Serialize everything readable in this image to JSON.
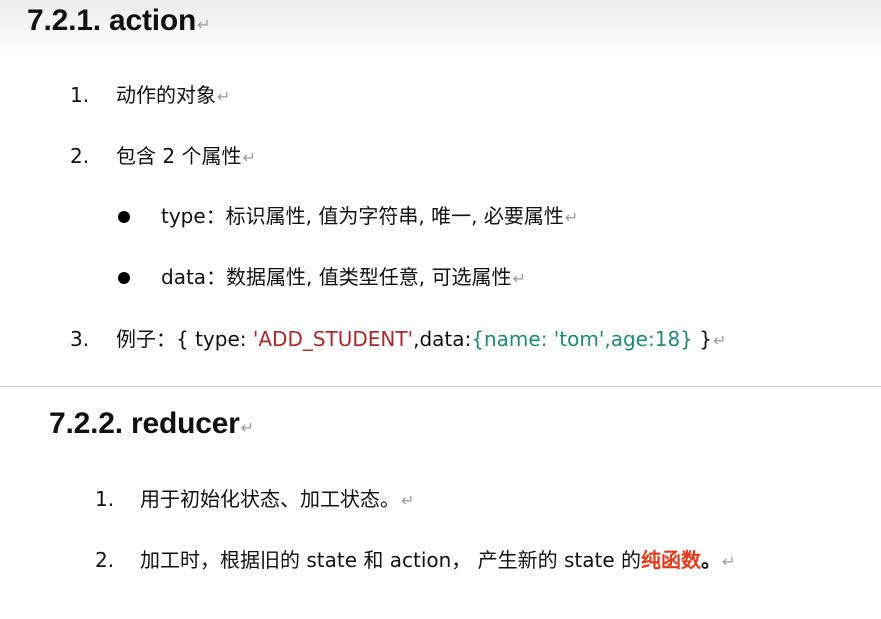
{
  "section1": {
    "title": "7.2.1. action",
    "items": [
      {
        "num": "1.",
        "text": "动作的对象"
      },
      {
        "num": "2.",
        "text": "包含 2 个属性"
      },
      {
        "num": "3.",
        "label": "例子：{ type: ",
        "code_type": "'ADD_STUDENT'",
        "code_data_key": ",data:",
        "code_obj": "{name: 'tom',age:18}",
        "closing": " }"
      }
    ],
    "bullets": [
      {
        "key": "type",
        "text": "：标识属性, 值为字符串, 唯一, 必要属性"
      },
      {
        "key": "data",
        "text": "：数据属性, 值类型任意, 可选属性"
      }
    ]
  },
  "section2": {
    "title": "7.2.2. reducer",
    "items": [
      {
        "num": "1.",
        "text": "用于初始化状态、加工状态。"
      },
      {
        "num": "2.",
        "text": "加工时，根据旧的 state 和 action， 产生新的 state 的",
        "emphasis": "纯函数",
        "end": "。"
      }
    ]
  },
  "paragraph_mark": "↵",
  "colors": {
    "string_red": "#a52a2a",
    "object_green": "#1f8a75",
    "emphasis_red": "#e03a1a"
  }
}
